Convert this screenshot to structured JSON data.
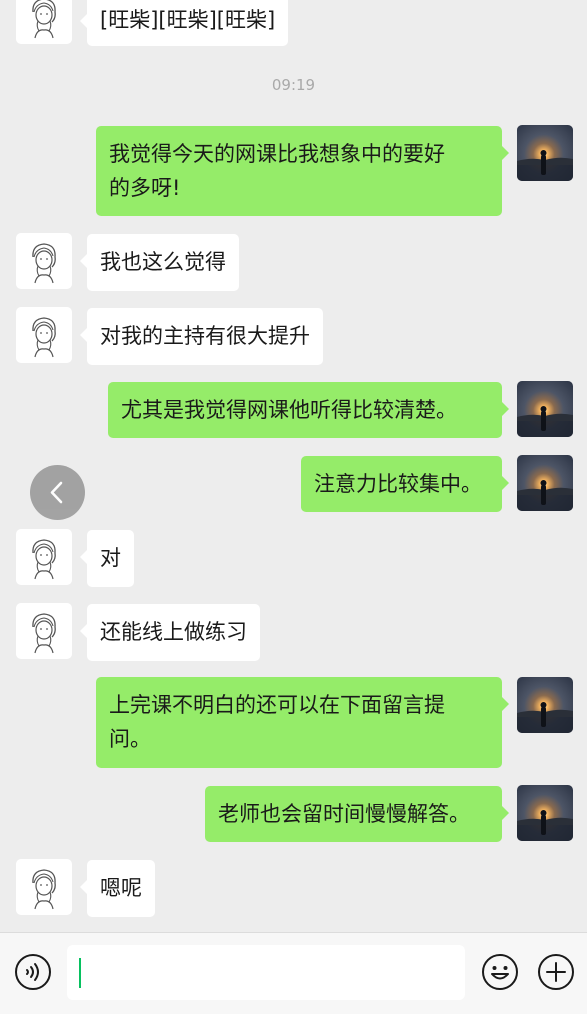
{
  "messages": [
    {
      "side": "in",
      "text": "[旺柴][旺柴][旺柴]"
    },
    {
      "timestamp": "09:19"
    },
    {
      "side": "out",
      "lines": [
        "我觉得今天的网课比我想象中的要好",
        "的多呀!"
      ]
    },
    {
      "side": "in",
      "text": "我也这么觉得"
    },
    {
      "side": "in",
      "text": "对我的主持有很大提升"
    },
    {
      "side": "out",
      "text": "尤其是我觉得网课他听得比较清楚。"
    },
    {
      "side": "out",
      "text": "注意力比较集中。"
    },
    {
      "side": "in",
      "text": "对"
    },
    {
      "side": "in",
      "text": "还能线上做练习"
    },
    {
      "side": "out",
      "lines": [
        "上完课不明白的还可以在下面留言提",
        "问。"
      ]
    },
    {
      "side": "out",
      "text": "老师也会留时间慢慢解答。"
    },
    {
      "side": "in",
      "text": "嗯呢"
    }
  ],
  "icons": {
    "back": "chevron-left-icon",
    "voice": "voice-icon",
    "emoji": "emoji-icon",
    "more": "plus-icon"
  },
  "colors": {
    "chat_background": "#ededed",
    "outgoing_bubble": "#95ec69",
    "incoming_bubble": "#ffffff",
    "cursor": "#07c160"
  },
  "input": {
    "value": ""
  }
}
